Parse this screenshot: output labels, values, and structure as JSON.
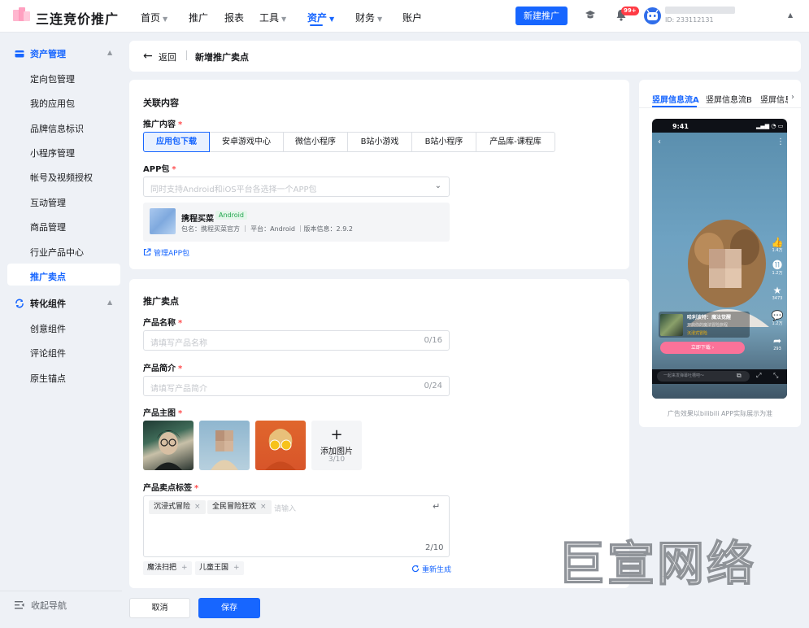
{
  "app": {
    "title": "三连竞价推广"
  },
  "topnav": [
    {
      "label": "首页",
      "caret": true
    },
    {
      "label": "推广",
      "caret": false
    },
    {
      "label": "报表",
      "caret": false
    },
    {
      "label": "工具",
      "caret": true
    },
    {
      "label": "资产",
      "caret": true,
      "active": true
    },
    {
      "label": "财务",
      "caret": true
    },
    {
      "label": "账户",
      "caret": false
    }
  ],
  "header": {
    "new_promo_button": "新建推广",
    "notification_badge": "99+",
    "user_id": "ID: 233112131"
  },
  "sidebar": {
    "groups": [
      {
        "label": "资产管理",
        "items": [
          "定向包管理",
          "我的应用包",
          "品牌信息标识",
          "小程序管理",
          "帐号及视频授权",
          "互动管理",
          "商品管理",
          "行业产品中心",
          "推广卖点"
        ]
      },
      {
        "label": "转化组件",
        "items": [
          "创意组件",
          "评论组件",
          "原生锚点"
        ]
      }
    ],
    "active_item": "推广卖点",
    "collapse_label": "收起导航"
  },
  "page": {
    "back_label": "返回",
    "title": "新增推广卖点"
  },
  "section1": {
    "title": "关联内容",
    "content_label": "推广内容",
    "content_options": [
      "应用包下载",
      "安卓游戏中心",
      "微信小程序",
      "B站小游戏",
      "B站小程序",
      "产品库-课程库"
    ],
    "content_selected": "应用包下载",
    "app_label": "APP包",
    "app_placeholder": "同时支持Android和iOS平台各选择一个APP包",
    "app_card": {
      "name": "携程买菜",
      "platform_tag": "Android",
      "meta": "包名：携程买菜官方 ｜ 平台：Android ｜版本信息：2.9.2"
    },
    "manage_link": "管理APP包"
  },
  "section2": {
    "title": "推广卖点",
    "name_label": "产品名称",
    "name_placeholder": "请填写产品名称",
    "name_count": "0/16",
    "intro_label": "产品简介",
    "intro_placeholder": "请填写产品简介",
    "intro_count": "0/24",
    "image_label": "产品主图",
    "add_image_label": "添加图片",
    "image_count": "3/10",
    "tags_label": "产品卖点标签",
    "tags": [
      "沉浸式冒险",
      "全民冒险狂欢"
    ],
    "tags_placeholder": "请输入",
    "tags_count": "2/10",
    "suggestions": [
      "魔法扫把",
      "儿童王国"
    ],
    "regenerate_label": "重新生成"
  },
  "footer": {
    "cancel_label": "取消",
    "save_label": "保存"
  },
  "preview": {
    "tabs": [
      "竖屏信息流A",
      "竖屏信息流B",
      "竖屏信息"
    ],
    "active_tab": "竖屏信息流A",
    "status_time": "9:41",
    "side_counts": [
      "1.4万",
      "1.2万",
      "3473",
      "1.2万",
      "293"
    ],
    "ad_title": "哈利波特：魔法觉醒",
    "ad_subtitle": "开启你的魔法冒险旅程",
    "ad_tag": "沉浸式冒险",
    "ad_cta": "立即下载 ›",
    "danmaku_placeholder": "一起来发弹幕吐槽吧～",
    "note": "广告效果以bilibili APP实际展示为准"
  },
  "watermark": "巨宣网络",
  "colors": {
    "accent": "#1766ff",
    "danger": "#ff4d4f",
    "cta_pink": "#fb7299",
    "success_tag": "#1fa54c"
  }
}
